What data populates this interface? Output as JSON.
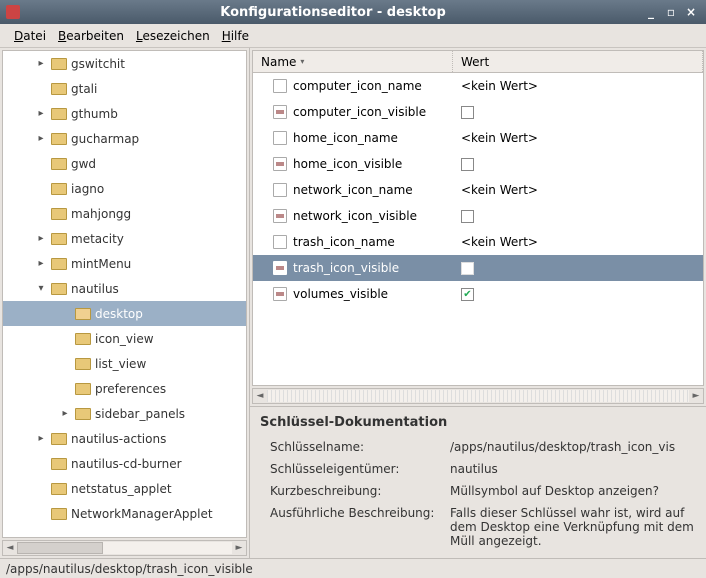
{
  "window": {
    "title": "Konfigurationseditor - desktop"
  },
  "menu": {
    "datei": "Datei",
    "bearbeiten": "Bearbeiten",
    "lesezeichen": "Lesezeichen",
    "hilfe": "Hilfe"
  },
  "tree": {
    "items": [
      {
        "label": "gswitchit",
        "depth": 1,
        "expandable": true
      },
      {
        "label": "gtali",
        "depth": 1,
        "expandable": false
      },
      {
        "label": "gthumb",
        "depth": 1,
        "expandable": true
      },
      {
        "label": "gucharmap",
        "depth": 1,
        "expandable": true
      },
      {
        "label": "gwd",
        "depth": 1,
        "expandable": false
      },
      {
        "label": "iagno",
        "depth": 1,
        "expandable": false
      },
      {
        "label": "mahjongg",
        "depth": 1,
        "expandable": false
      },
      {
        "label": "metacity",
        "depth": 1,
        "expandable": true
      },
      {
        "label": "mintMenu",
        "depth": 1,
        "expandable": true
      },
      {
        "label": "nautilus",
        "depth": 1,
        "expandable": true,
        "expanded": true
      },
      {
        "label": "desktop",
        "depth": 2,
        "expandable": false,
        "selected": true
      },
      {
        "label": "icon_view",
        "depth": 2,
        "expandable": false
      },
      {
        "label": "list_view",
        "depth": 2,
        "expandable": false
      },
      {
        "label": "preferences",
        "depth": 2,
        "expandable": false
      },
      {
        "label": "sidebar_panels",
        "depth": 2,
        "expandable": true
      },
      {
        "label": "nautilus-actions",
        "depth": 1,
        "expandable": true
      },
      {
        "label": "nautilus-cd-burner",
        "depth": 1,
        "expandable": false
      },
      {
        "label": "netstatus_applet",
        "depth": 1,
        "expandable": false
      },
      {
        "label": "NetworkManagerApplet",
        "depth": 1,
        "expandable": false
      }
    ]
  },
  "table": {
    "headers": {
      "name": "Name",
      "value": "Wert"
    },
    "rows": [
      {
        "name": "computer_icon_name",
        "type": "string",
        "value": "<kein Wert>"
      },
      {
        "name": "computer_icon_visible",
        "type": "bool",
        "checked": false
      },
      {
        "name": "home_icon_name",
        "type": "string",
        "value": "<kein Wert>"
      },
      {
        "name": "home_icon_visible",
        "type": "bool",
        "checked": false
      },
      {
        "name": "network_icon_name",
        "type": "string",
        "value": "<kein Wert>"
      },
      {
        "name": "network_icon_visible",
        "type": "bool",
        "checked": false
      },
      {
        "name": "trash_icon_name",
        "type": "string",
        "value": "<kein Wert>"
      },
      {
        "name": "trash_icon_visible",
        "type": "bool",
        "checked": false,
        "selected": true
      },
      {
        "name": "volumes_visible",
        "type": "bool",
        "checked": true
      }
    ]
  },
  "doc": {
    "heading": "Schlüssel-Dokumentation",
    "name_label": "Schlüsselname:",
    "name_value": "/apps/nautilus/desktop/trash_icon_vis",
    "owner_label": "Schlüsseleigentümer:",
    "owner_value": "nautilus",
    "short_label": "Kurzbeschreibung:",
    "short_value": "Müllsymbol auf Desktop anzeigen?",
    "long_label": "Ausführliche Beschreibung:",
    "long_value": "Falls dieser Schlüssel wahr ist, wird auf dem Desktop eine Verknüpfung mit dem Müll angezeigt."
  },
  "statusbar": {
    "path": "/apps/nautilus/desktop/trash_icon_visible"
  }
}
